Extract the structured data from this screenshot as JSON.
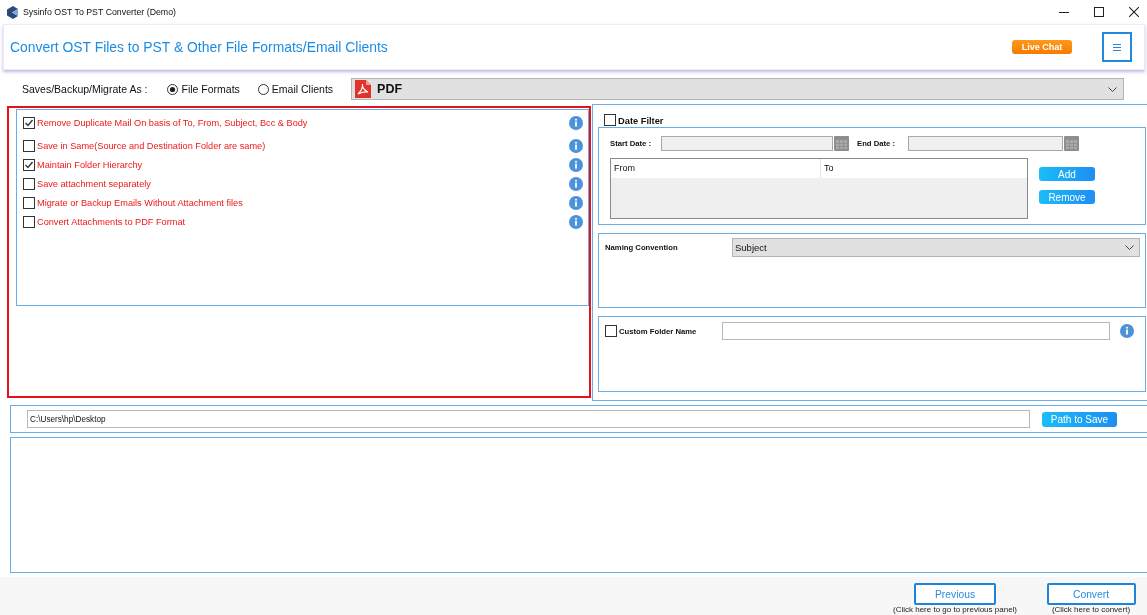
{
  "window": {
    "title": "Sysinfo OST To PST Converter (Demo)"
  },
  "header": {
    "title": "Convert OST Files to PST & Other File Formats/Email Clients",
    "live_chat": "Live Chat"
  },
  "save_as": {
    "label": "Saves/Backup/Migrate As :",
    "options": [
      {
        "label": "File Formats",
        "selected": true
      },
      {
        "label": "Email Clients",
        "selected": false
      }
    ],
    "format": "PDF"
  },
  "options": [
    {
      "label": "Remove Duplicate Mail On basis of To, From, Subject, Bcc & Body",
      "checked": true
    },
    {
      "label": "Save in Same(Source and Destination Folder are same)",
      "checked": false
    },
    {
      "label": "Maintain Folder Hierarchy",
      "checked": true
    },
    {
      "label": "Save attachment separately",
      "checked": false
    },
    {
      "label": "Migrate or Backup Emails Without Attachment files",
      "checked": false
    },
    {
      "label": "Convert Attachments to PDF Format",
      "checked": false
    }
  ],
  "date_filter": {
    "label": "Date Filter",
    "checked": false,
    "start_label": "Start Date :",
    "end_label": "End Date :",
    "columns": [
      "From",
      "To"
    ],
    "buttons": [
      "Add",
      "Remove"
    ]
  },
  "naming_convention": {
    "label": "Naming Convention",
    "value": "Subject"
  },
  "custom_folder": {
    "label": "Custom Folder Name",
    "checked": false
  },
  "path": {
    "value": "C:\\Users\\hp\\Desktop",
    "button": "Path to Save"
  },
  "footer": {
    "buttons": [
      {
        "label": "Previous",
        "hint": "(Click here to go to previous panel)"
      },
      {
        "label": "Convert",
        "hint": "(Click here to convert)"
      }
    ]
  }
}
